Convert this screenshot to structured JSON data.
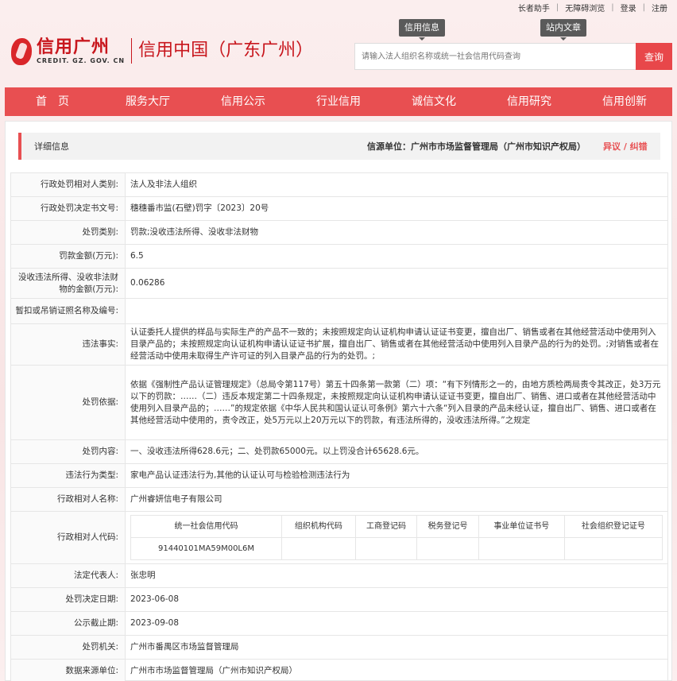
{
  "topbar": {
    "elder": "长者助手",
    "accessible": "无障碍浏览",
    "login": "登录",
    "register": "注册",
    "separator": "|"
  },
  "logo": {
    "cn": "信用广州",
    "en": "CREDIT. GZ. GOV. CN",
    "sub": "信用中国（广东广州）"
  },
  "tags": {
    "info": "信用信息",
    "news": "站内文章"
  },
  "search": {
    "placeholder": "请输入法人组织名称或统一社会信用代码查询",
    "button": "查询"
  },
  "nav": [
    {
      "label": "首　页"
    },
    {
      "label": "服务大厅"
    },
    {
      "label": "信用公示"
    },
    {
      "label": "行业信用"
    },
    {
      "label": "诚信文化"
    },
    {
      "label": "信用研究"
    },
    {
      "label": "信用创新"
    }
  ],
  "detail": {
    "title": "详细信息",
    "source": "信源单位：广州市市场监督管理局（广州市知识产权局）",
    "objection": "异议 / 纠错"
  },
  "rows": [
    {
      "label": "行政处罚相对人类别:",
      "value": "法人及非法人组织"
    },
    {
      "label": "行政处罚决定书文号:",
      "value": "穗穗番市监(石壁)罚字〔2023〕20号"
    },
    {
      "label": "处罚类别:",
      "value": "罚款;没收违法所得、没收非法财物"
    },
    {
      "label": "罚款金额(万元):",
      "value": "6.5"
    },
    {
      "label": "没收违法所得、没收非法财物的金额(万元):",
      "value": "0.06286"
    },
    {
      "label": "暂扣或吊销证照名称及编号:",
      "value": ""
    },
    {
      "label": "违法事实:",
      "value": "认证委托人提供的样品与实际生产的产品不一致的；未按照规定向认证机构申请认证证书变更，擅自出厂、销售或者在其他经营活动中使用列入目录产品的；未按照规定向认证机构申请认证证书扩展，擅自出厂、销售或者在其他经营活动中使用列入目录产品的行为的处罚。;对销售或者在经营活动中使用未取得生产许可证的列入目录产品的行为的处罚。;"
    },
    {
      "label": "处罚依据:",
      "value": "依据《强制性产品认证管理规定》（总局令第117号）第五十四条第一款第（二）项：“有下列情形之一的，由地方质检两局责令其改正，处3万元以下的罚款：……（二）违反本规定第二十四条规定，未按照规定向认证机构申请认证证书变更，擅自出厂、销售、进口或者在其他经营活动中使用列入目录产品的；……”的规定依据《中华人民共和国认证认可条例》第六十六条“列入目录的产品未经认证，擅自出厂、销售、进口或者在其他经营活动中使用的，责令改正，处5万元以上20万元以下的罚款，有违法所得的，没收违法所得。”之规定"
    },
    {
      "label": "处罚内容:",
      "value": "一、没收违法所得628.6元；二、处罚款65000元。以上罚没合计65628.6元。"
    },
    {
      "label": "违法行为类型:",
      "value": "家电产品认证违法行为,其他的认证认可与检验检测违法行为"
    },
    {
      "label": "行政相对人名称:",
      "value": "广州睿妍信电子有限公司"
    }
  ],
  "codes": {
    "label": "行政相对人代码:",
    "headers": [
      "统一社会信用代码",
      "组织机构代码",
      "工商登记码",
      "税务登记号",
      "事业单位证书号",
      "社会组织登记证号"
    ],
    "values": [
      "91440101MA59M00L6M",
      "",
      "",
      "",
      "",
      ""
    ]
  },
  "rows2": [
    {
      "label": "法定代表人:",
      "value": "张忠明"
    },
    {
      "label": "处罚决定日期:",
      "value": "2023-06-08"
    },
    {
      "label": "公示截止期:",
      "value": "2023-09-08"
    },
    {
      "label": "处罚机关:",
      "value": "广州市番禺区市场监督管理局"
    },
    {
      "label": "数据来源单位:",
      "value": "广州市市场监督管理局（广州市知识产权局）"
    }
  ]
}
